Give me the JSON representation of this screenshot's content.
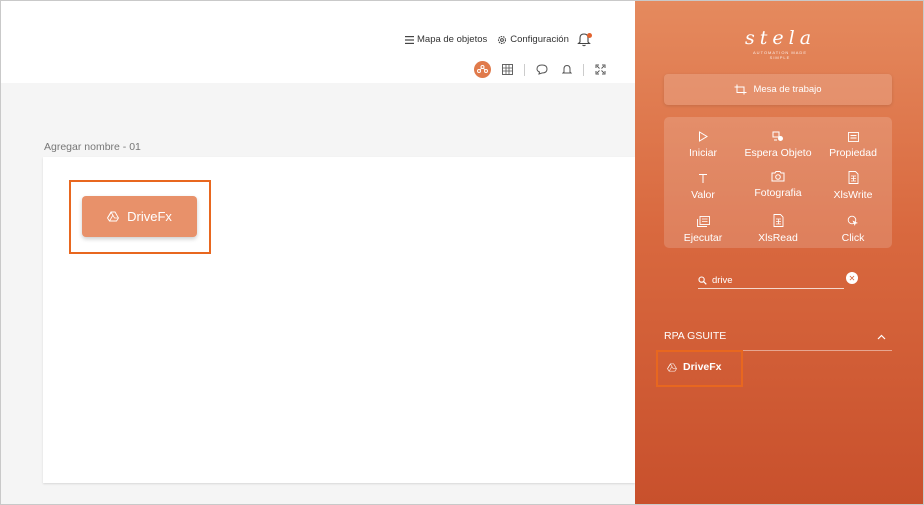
{
  "header": {
    "object_map_label": "Mapa de objetos",
    "settings_label": "Configuración"
  },
  "canvas": {
    "title": "Agregar nombre - 01",
    "node_label": "DriveFx"
  },
  "panel": {
    "logo_text": "stela",
    "logo_tagline": "AUTOMATION MADE SIMPLE",
    "workbench_label": "Mesa de trabajo",
    "tools": [
      {
        "label": "Iniciar",
        "icon": "play-icon"
      },
      {
        "label": "Espera Objeto",
        "icon": "wait-object-icon"
      },
      {
        "label": "Propiedad",
        "icon": "property-icon"
      },
      {
        "label": "Valor",
        "icon": "text-icon"
      },
      {
        "label": "Fotografia",
        "icon": "camera-icon"
      },
      {
        "label": "XlsWrite",
        "icon": "spreadsheet-icon"
      },
      {
        "label": "Ejecutar",
        "icon": "execute-icon"
      },
      {
        "label": "XlsRead",
        "icon": "spreadsheet-icon"
      },
      {
        "label": "Click",
        "icon": "cursor-click-icon"
      }
    ],
    "search": {
      "value": "drive"
    },
    "group": {
      "title": "RPA GSUITE"
    },
    "result": {
      "label": "DriveFx"
    }
  },
  "colors": {
    "accent": "#e8671f",
    "node_bg": "#e8916a",
    "panel_top": "#e58a5e",
    "panel_bottom": "#c8502c"
  }
}
